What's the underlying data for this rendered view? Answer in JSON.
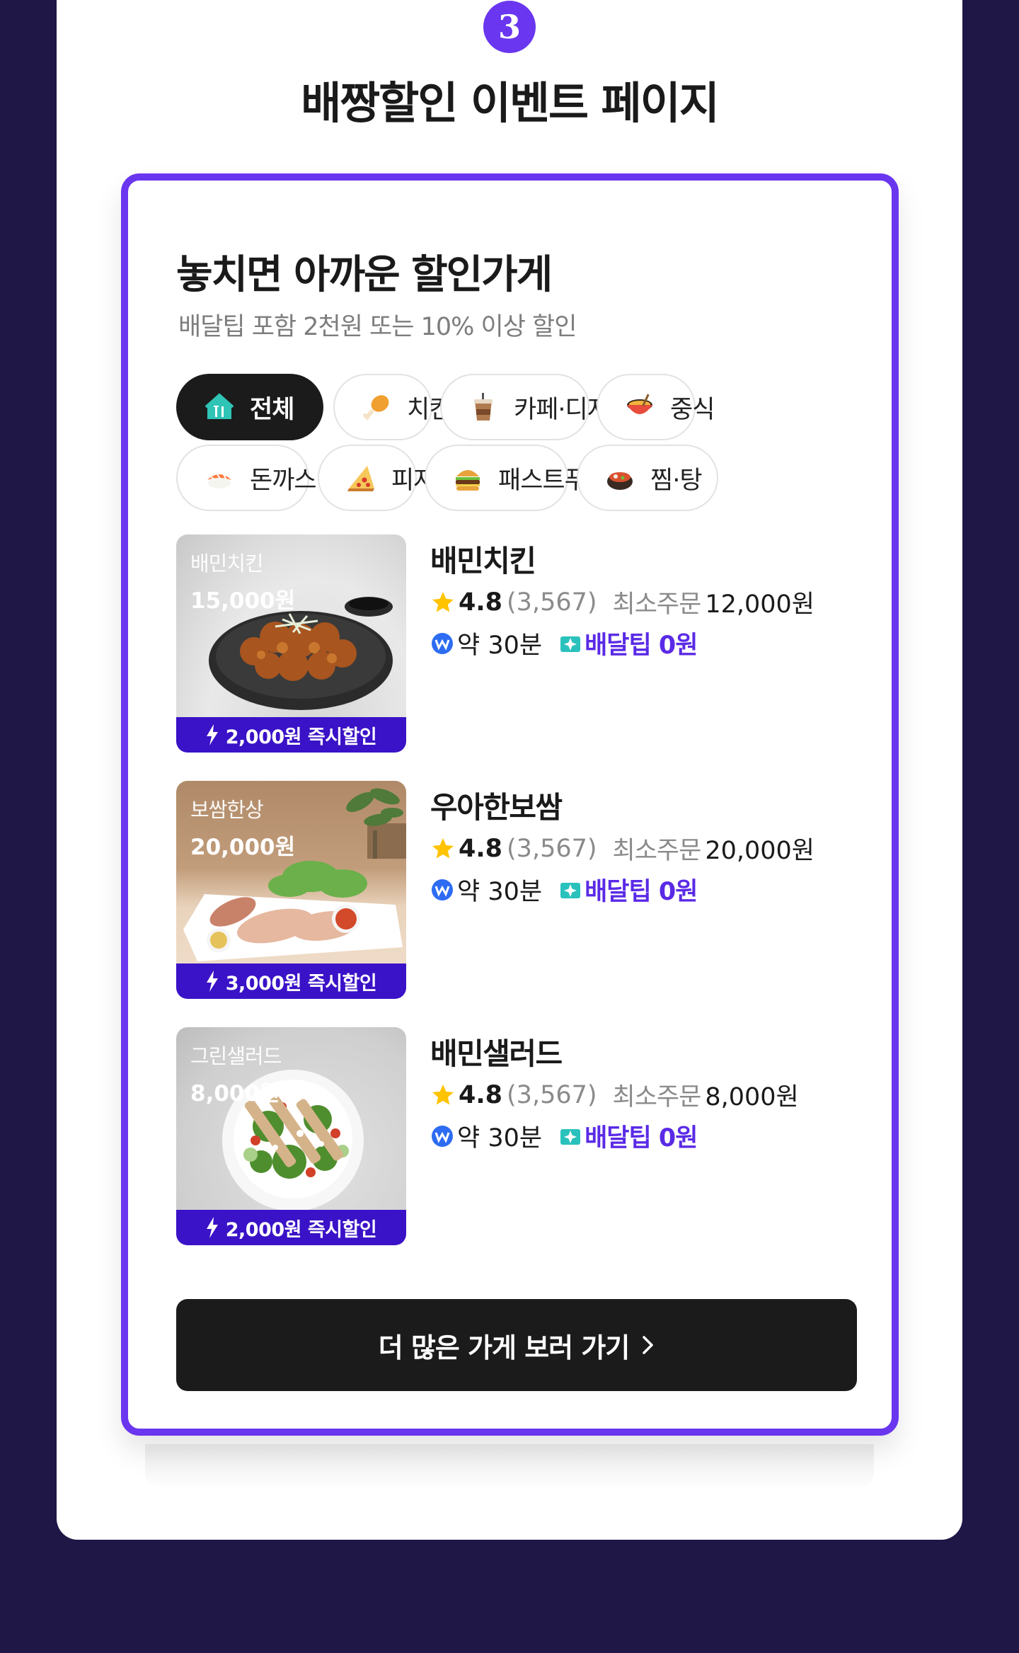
{
  "step": {
    "number": "3",
    "title": "배짱할인 이벤트 페이지"
  },
  "headline": "놓치면 아까운 할인가게",
  "subline": "배달팁 포함 2천원 또는 10% 이상 할인",
  "categories": [
    {
      "label": "전체",
      "icon": "home-icon",
      "selected": true
    },
    {
      "label": "치킨",
      "icon": "chicken-leg-icon"
    },
    {
      "label": "카페·디저트",
      "icon": "coffee-cup-icon"
    },
    {
      "label": "중식",
      "icon": "noodle-bowl-icon"
    },
    {
      "label": "돈까스·회",
      "icon": "sushi-icon"
    },
    {
      "label": "피자",
      "icon": "pizza-icon"
    },
    {
      "label": "패스트푸드",
      "icon": "burger-icon"
    },
    {
      "label": "찜·탕",
      "icon": "stew-pot-icon"
    }
  ],
  "stores": [
    {
      "name": "배민치킨",
      "thumb_name": "배민치킨",
      "thumb_price": "15,000원",
      "deal": "2,000원 즉시할인",
      "rating": "4.8",
      "reviews": "(3,567)",
      "min_label": "최소주문",
      "min_value": "12,000원",
      "eta": "약 30분",
      "tip": "배달팁 0원"
    },
    {
      "name": "우아한보쌈",
      "thumb_name": "보쌈한상",
      "thumb_price": "20,000원",
      "deal": "3,000원 즉시할인",
      "rating": "4.8",
      "reviews": "(3,567)",
      "min_label": "최소주문",
      "min_value": "20,000원",
      "eta": "약 30분",
      "tip": "배달팁 0원"
    },
    {
      "name": "배민샐러드",
      "thumb_name": "그린샐러드",
      "thumb_price": "8,000원",
      "deal": "2,000원 즉시할인",
      "rating": "4.8",
      "reviews": "(3,567)",
      "min_label": "최소주문",
      "min_value": "8,000원",
      "eta": "약 30분",
      "tip": "배달팁 0원"
    }
  ],
  "more_button": "더 많은 가게 보러 가기",
  "colors": {
    "accent": "#6a36ef",
    "deal_bar": "#3a12c7",
    "tip_text": "#5a2ae6",
    "background": "#1f1745"
  }
}
